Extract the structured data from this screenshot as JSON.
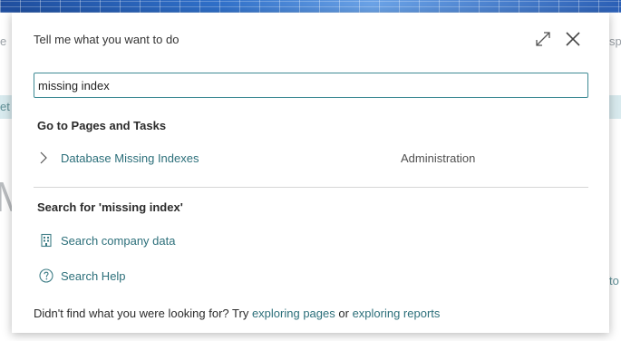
{
  "background": {
    "left_fragment_1": "e",
    "left_fragment_2": "et",
    "left_big": "M",
    "right_fragment_1": "sp",
    "right_fragment_2": "to"
  },
  "dialog": {
    "title": "Tell me what you want to do",
    "search": {
      "value": "missing index",
      "placeholder": ""
    },
    "pages_section": {
      "heading": "Go to Pages and Tasks",
      "results": [
        {
          "label": "Database Missing Indexes",
          "category": "Administration"
        }
      ]
    },
    "search_section": {
      "heading": "Search for 'missing index'",
      "company_data_label": "Search company data",
      "help_label": "Search Help"
    },
    "footer": {
      "prefix": "Didn't find what you were looking for? Try",
      "link_pages": "exploring pages",
      "middle": "or",
      "link_reports": "exploring reports"
    }
  },
  "colors": {
    "accent": "#3e8a94",
    "link": "#2c6f7a"
  },
  "icons": {
    "expand": "expand-icon",
    "close": "close-icon",
    "chevron": "chevron-right-icon",
    "company_data": "building-icon",
    "help": "help-circle-icon"
  }
}
